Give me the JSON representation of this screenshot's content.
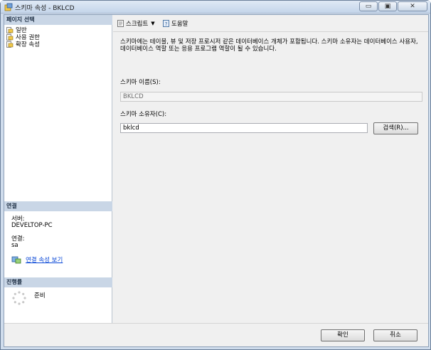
{
  "window": {
    "title": "스키마 속성 - BKLCD",
    "minimize_label": "▭",
    "maximize_label": "▣",
    "close_label": "✕"
  },
  "left": {
    "page_select_header": "페이지 선택",
    "pages": [
      {
        "label": "일반",
        "icon": "page-icon"
      },
      {
        "label": "사용 권한",
        "icon": "page-icon"
      },
      {
        "label": "확장 속성",
        "icon": "page-icon"
      }
    ],
    "connection_header": "연결",
    "server_label": "서버:",
    "server_value": "DEVELTOP-PC",
    "conn_label": "연결:",
    "conn_value": "sa",
    "conn_props_link": "연결 속성 보기",
    "progress_header": "진행률",
    "progress_status": "준비"
  },
  "toolbar": {
    "script_label": "스크립트",
    "help_label": "도움말"
  },
  "main": {
    "description": "스키마에는 테이블, 뷰 및 저장 프로시저 같은 데이터베이스 개체가 포함됩니다. 스키마 소유자는 데이터베이스 사용자, 데이터베이스 역할 또는 응용 프로그램 역할이 될 수 있습니다.",
    "schema_name_label": "스키마 이름(S):",
    "schema_name_value": "BKLCD",
    "schema_owner_label": "스키마 소유자(C):",
    "schema_owner_value": "bklcd",
    "search_button": "검색(R)..."
  },
  "footer": {
    "ok_button": "확인",
    "cancel_button": "취소"
  },
  "colors": {
    "link": "#0645d6",
    "section_header": "#c9d6e6",
    "titlebar": "#c4d5ea"
  }
}
